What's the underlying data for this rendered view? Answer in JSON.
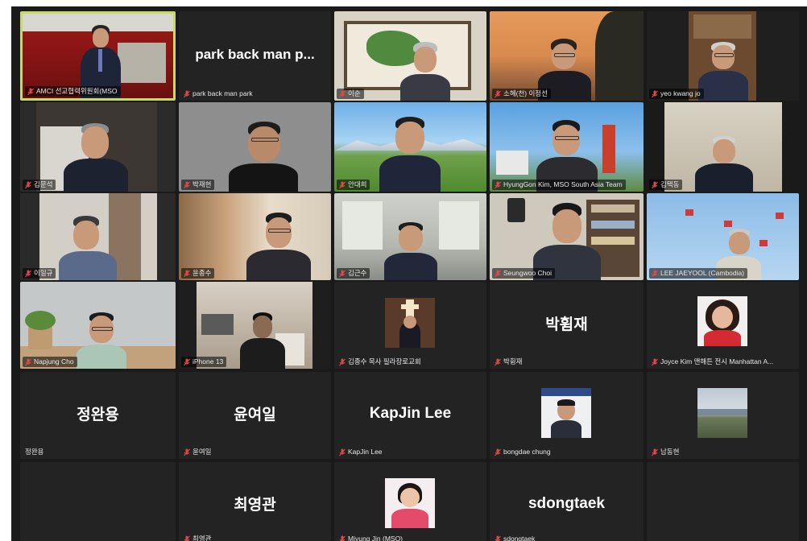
{
  "tiles": {
    "t1": {
      "name": "AMCI 선교협력위원회(MSO",
      "big": ""
    },
    "t2": {
      "name": "park back man park",
      "big": "park back man p..."
    },
    "t3": {
      "name": "이순",
      "big": ""
    },
    "t4": {
      "name": "소혜(천) 이정선",
      "big": ""
    },
    "t5": {
      "name": "yeo kwang jo",
      "big": ""
    },
    "t6": {
      "name": "김문석",
      "big": ""
    },
    "t7": {
      "name": "박재현",
      "big": ""
    },
    "t8": {
      "name": "안대희",
      "big": ""
    },
    "t9": {
      "name": "HyungGon Kim, MSO South Asia Team",
      "big": ""
    },
    "t10": {
      "name": "김택동",
      "big": ""
    },
    "t11": {
      "name": "이일규",
      "big": ""
    },
    "t12": {
      "name": "윤종수",
      "big": ""
    },
    "t13": {
      "name": "김근수",
      "big": ""
    },
    "t14": {
      "name": "Seungwoo Choi",
      "big": ""
    },
    "t15": {
      "name": "LEE JAEYOOL (Cambodia)",
      "big": ""
    },
    "t16": {
      "name": "Napjung Cho",
      "big": ""
    },
    "t17": {
      "name": "iPhone 13",
      "big": ""
    },
    "t18": {
      "name": "김종수 목사 필라장로교회",
      "big": ""
    },
    "t19": {
      "name": "박휨재",
      "big": "박휨재"
    },
    "t20": {
      "name": "Joyce Kim 맨해튼 전시 Manhattan A...",
      "big": ""
    },
    "t21": {
      "name": "정완용",
      "big": "정완용"
    },
    "t22": {
      "name": "윤여일",
      "big": "윤여일"
    },
    "t23": {
      "name": "KapJin Lee",
      "big": "KapJin Lee"
    },
    "t24": {
      "name": "bongdae chung",
      "big": ""
    },
    "t25": {
      "name": "남동현",
      "big": ""
    },
    "t26": {
      "name": "",
      "big": ""
    },
    "t27": {
      "name": "최영관",
      "big": "최영관"
    },
    "t28": {
      "name": "Miyung Jin (MSO)",
      "big": ""
    },
    "t29": {
      "name": "sdongtaek",
      "big": "sdongtaek"
    },
    "t30": {
      "name": "",
      "big": ""
    }
  },
  "colors": {
    "background": "#1a1a1a",
    "tile": "#232323",
    "active_speaker_border": "#c8d96a",
    "mic_muted": "#e04848"
  },
  "icons": {
    "muted": "muted-mic-icon"
  }
}
